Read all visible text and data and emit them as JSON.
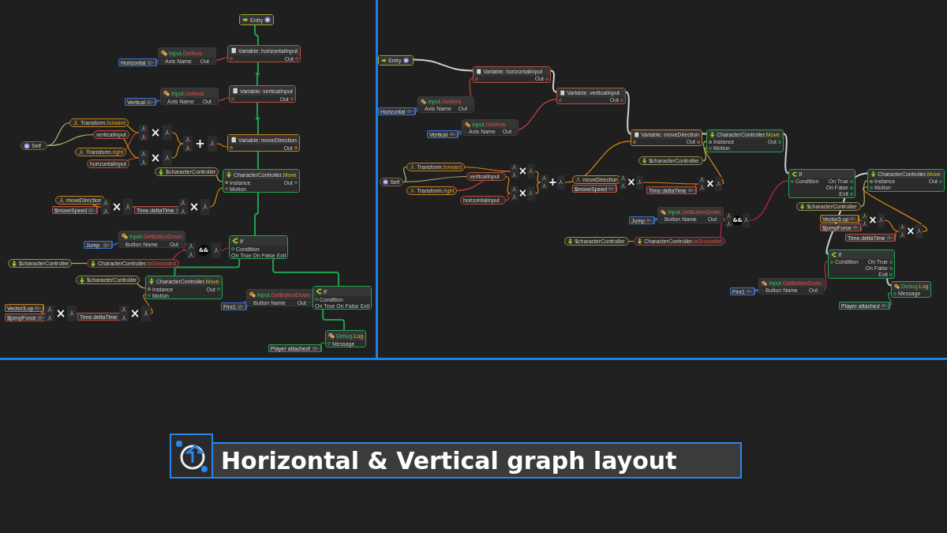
{
  "graphs": [
    {
      "kind": "vertical",
      "nodes": [
        {
          "kind": "entry",
          "title": "Entry",
          "color": "#a3a326"
        },
        {
          "kind": "literal",
          "value": "Horizontal",
          "color": "#3a70d6"
        },
        {
          "kind": "input",
          "title": "Input.",
          "member": {
            "text": "GetAxis",
            "kind": "query"
          },
          "color": "#3b3b3b",
          "inputs": [
            "Axis Name"
          ],
          "outputs": [
            "Out"
          ]
        },
        {
          "kind": "variable",
          "title": "Variable: horizontalInput",
          "color": "#b8513f",
          "outputs": [
            "Out"
          ]
        },
        {
          "kind": "literal",
          "value": "Vertical",
          "color": "#3a70d6"
        },
        {
          "kind": "input",
          "title": "Input.",
          "member": {
            "text": "GetAxis",
            "kind": "query"
          },
          "color": "#3b3b3b",
          "inputs": [
            "Axis Name"
          ],
          "outputs": [
            "Out"
          ]
        },
        {
          "kind": "variable",
          "title": "Variable: verticalInput",
          "color": "#b8513f",
          "outputs": [
            "Out"
          ]
        },
        {
          "kind": "pill",
          "label": "Self",
          "color": "#6e6a50"
        },
        {
          "kind": "pill",
          "label": "Transform.",
          "member": {
            "text": "forward",
            "kind": "property"
          },
          "color": "#c7801c"
        },
        {
          "kind": "pill",
          "label": "verticalInput",
          "color": "#b8513f"
        },
        {
          "kind": "pill",
          "label": "Transform.",
          "member": {
            "text": "right",
            "kind": "property"
          },
          "color": "#c7801c"
        },
        {
          "kind": "pill",
          "label": "horizontalInput",
          "color": "#b8513f"
        },
        {
          "kind": "operator",
          "symbol": "×",
          "circled": false
        },
        {
          "kind": "operator",
          "symbol": "×",
          "circled": false
        },
        {
          "kind": "operator",
          "symbol": "+",
          "circled": false
        },
        {
          "kind": "variable",
          "title": "Variable: moveDirection",
          "color": "#c7801c",
          "outputs": [
            "Out"
          ]
        },
        {
          "kind": "pill",
          "label": "$characterController",
          "color": "#948c58"
        },
        {
          "kind": "component",
          "title": "CharacterController.",
          "member": {
            "text": "Move",
            "kind": "action"
          },
          "color": "#22a454",
          "inputs": [
            "Instance",
            "Motion"
          ],
          "outputs": [
            "Out"
          ]
        },
        {
          "kind": "pill",
          "label": "moveDirection",
          "color": "#c7801c"
        },
        {
          "kind": "literal",
          "value": "$moveSpeed",
          "color": "#b8513f"
        },
        {
          "kind": "operator",
          "symbol": "×",
          "circled": false
        },
        {
          "kind": "literal",
          "value": "Time.deltaTime",
          "color": "#b8513f"
        },
        {
          "kind": "operator",
          "symbol": "×",
          "circled": false
        },
        {
          "kind": "literal",
          "value": "Jump",
          "color": "#3a70d6"
        },
        {
          "kind": "input",
          "title": "Input.",
          "member": {
            "text": "GetButtonDown",
            "kind": "query"
          },
          "color": "#3b3b3b",
          "inputs": [
            "Button Name"
          ],
          "outputs": [
            "Out"
          ]
        },
        {
          "kind": "pill",
          "label": "$characterController",
          "color": "#948c58"
        },
        {
          "kind": "pill",
          "label": "CharacterController.",
          "member": {
            "text": "isGrounded",
            "kind": "query"
          },
          "color": "#c42a4a"
        },
        {
          "kind": "operator",
          "symbol": "&&",
          "circled": true
        },
        {
          "kind": "branch",
          "title": "If",
          "color": "#22a454",
          "inputs": [
            "Condition"
          ],
          "outputs": [
            "On True",
            "On False",
            "Exit"
          ]
        },
        {
          "kind": "pill",
          "label": "$characterController",
          "color": "#948c58"
        },
        {
          "kind": "component",
          "title": "CharacterController.",
          "member": {
            "text": "Move",
            "kind": "action"
          },
          "color": "#22a454",
          "inputs": [
            "Instance",
            "Motion"
          ],
          "outputs": [
            "Out"
          ]
        },
        {
          "kind": "literal",
          "value": "Vector3.up",
          "color": "#c7801c"
        },
        {
          "kind": "literal",
          "value": "$jumpForce",
          "color": "#b8513f"
        },
        {
          "kind": "operator",
          "symbol": "×",
          "circled": false
        },
        {
          "kind": "literal",
          "value": "Time.deltaTime",
          "color": "#b8513f"
        },
        {
          "kind": "operator",
          "symbol": "×",
          "circled": false
        },
        {
          "kind": "literal",
          "value": "Fire1",
          "color": "#3a70d6"
        },
        {
          "kind": "input",
          "title": "Input.",
          "member": {
            "text": "GetButtonDown",
            "kind": "query"
          },
          "color": "#3b3b3b",
          "inputs": [
            "Button Name"
          ],
          "outputs": [
            "Out"
          ]
        },
        {
          "kind": "branch",
          "title": "If",
          "color": "#22a454",
          "inputs": [
            "Condition"
          ],
          "outputs": [
            "On True",
            "On False",
            "Exit"
          ]
        },
        {
          "kind": "literal",
          "value": "Player attached!",
          "color": "#2d9a52"
        },
        {
          "kind": "log",
          "title": "Debug.",
          "member": {
            "text": "Log",
            "kind": "action"
          },
          "color": "#22a454",
          "inputs": [
            "Message"
          ]
        }
      ]
    },
    {
      "kind": "horizontal",
      "nodes": [
        {
          "kind": "entry",
          "title": "Entry",
          "color": "#a3a326"
        },
        {
          "kind": "literal",
          "value": "Horizontal",
          "color": "#3a70d6"
        },
        {
          "kind": "input",
          "title": "Input.",
          "member": {
            "text": "GetAxis",
            "kind": "query"
          },
          "color": "#3b3b3b",
          "inputs": [
            "Axis Name"
          ],
          "outputs": [
            "Out"
          ]
        },
        {
          "kind": "variable",
          "title": "Variable: horizontalInput",
          "color": "#b8513f",
          "outputs": [
            "Out"
          ]
        },
        {
          "kind": "literal",
          "value": "Vertical",
          "color": "#3a70d6"
        },
        {
          "kind": "input",
          "title": "Input.",
          "member": {
            "text": "GetAxis",
            "kind": "query"
          },
          "color": "#3b3b3b",
          "inputs": [
            "Axis Name"
          ],
          "outputs": [
            "Out"
          ]
        },
        {
          "kind": "variable",
          "title": "Variable: verticalInput",
          "color": "#b8513f",
          "outputs": [
            "Out"
          ]
        },
        {
          "kind": "pill",
          "label": "Self",
          "color": "#6e6a50"
        },
        {
          "kind": "pill",
          "label": "Transform.",
          "member": {
            "text": "forward",
            "kind": "property"
          },
          "color": "#c7801c"
        },
        {
          "kind": "pill",
          "label": "verticalInput",
          "color": "#b8513f"
        },
        {
          "kind": "pill",
          "label": "Transform.",
          "member": {
            "text": "right",
            "kind": "property"
          },
          "color": "#c7801c"
        },
        {
          "kind": "pill",
          "label": "horizontalInput",
          "color": "#b8513f"
        },
        {
          "kind": "operator",
          "symbol": "×",
          "circled": false
        },
        {
          "kind": "operator",
          "symbol": "×",
          "circled": false
        },
        {
          "kind": "operator",
          "symbol": "+",
          "circled": false
        },
        {
          "kind": "variable",
          "title": "Variable: moveDirection",
          "color": "#c7801c",
          "outputs": [
            "Out"
          ]
        },
        {
          "kind": "pill",
          "label": "$characterController",
          "color": "#948c58"
        },
        {
          "kind": "component",
          "title": "CharacterController.",
          "member": {
            "text": "Move",
            "kind": "action"
          },
          "color": "#22a454",
          "inputs": [
            "Instance",
            "Motion"
          ],
          "outputs": [
            "Out"
          ]
        },
        {
          "kind": "pill",
          "label": "moveDirection",
          "color": "#c7801c"
        },
        {
          "kind": "literal",
          "value": "$moveSpeed",
          "color": "#b8513f"
        },
        {
          "kind": "operator",
          "symbol": "×",
          "circled": false
        },
        {
          "kind": "literal",
          "value": "Time.deltaTime",
          "color": "#b8513f"
        },
        {
          "kind": "operator",
          "symbol": "×",
          "circled": false
        },
        {
          "kind": "literal",
          "value": "Jump",
          "color": "#3a70d6"
        },
        {
          "kind": "input",
          "title": "Input.",
          "member": {
            "text": "GetButtonDown",
            "kind": "query"
          },
          "color": "#3b3b3b",
          "inputs": [
            "Button Name"
          ],
          "outputs": [
            "Out"
          ]
        },
        {
          "kind": "pill",
          "label": "$characterController",
          "color": "#948c58"
        },
        {
          "kind": "pill",
          "label": "CharacterController.",
          "member": {
            "text": "isGrounded",
            "kind": "query"
          },
          "color": "#c42a4a"
        },
        {
          "kind": "operator",
          "symbol": "&&",
          "circled": true
        },
        {
          "kind": "branch",
          "title": "If",
          "color": "#22a454",
          "inputs": [
            "Condition"
          ],
          "outputs": [
            "On True",
            "On False",
            "Exit"
          ]
        },
        {
          "kind": "pill",
          "label": "$characterController",
          "color": "#948c58"
        },
        {
          "kind": "component",
          "title": "CharacterController.",
          "member": {
            "text": "Move",
            "kind": "action"
          },
          "color": "#22a454",
          "inputs": [
            "Instance",
            "Motion"
          ],
          "outputs": [
            "Out"
          ]
        },
        {
          "kind": "literal",
          "value": "Vector3.up",
          "color": "#c7801c"
        },
        {
          "kind": "literal",
          "value": "$jumpForce",
          "color": "#b8513f"
        },
        {
          "kind": "operator",
          "symbol": "×",
          "circled": false
        },
        {
          "kind": "literal",
          "value": "Time.deltaTime",
          "color": "#b8513f"
        },
        {
          "kind": "operator",
          "symbol": "×",
          "circled": false
        },
        {
          "kind": "literal",
          "value": "Fire1",
          "color": "#3a70d6"
        },
        {
          "kind": "input",
          "title": "Input.",
          "member": {
            "text": "GetButtonDown",
            "kind": "query"
          },
          "color": "#3b3b3b",
          "inputs": [
            "Button Name"
          ],
          "outputs": [
            "Out"
          ]
        },
        {
          "kind": "branch",
          "title": "If",
          "color": "#22a454",
          "inputs": [
            "Condition"
          ],
          "outputs": [
            "On True",
            "On False",
            "Exit"
          ]
        },
        {
          "kind": "literal",
          "value": "Player attached",
          "color": "#2d9a52"
        },
        {
          "kind": "log",
          "title": "Debug.",
          "member": {
            "text": "Log",
            "kind": "action"
          },
          "color": "#22a454",
          "inputs": [
            "Message"
          ]
        }
      ]
    }
  ],
  "banner": {
    "title": "Horizontal & Vertical graph layout"
  }
}
